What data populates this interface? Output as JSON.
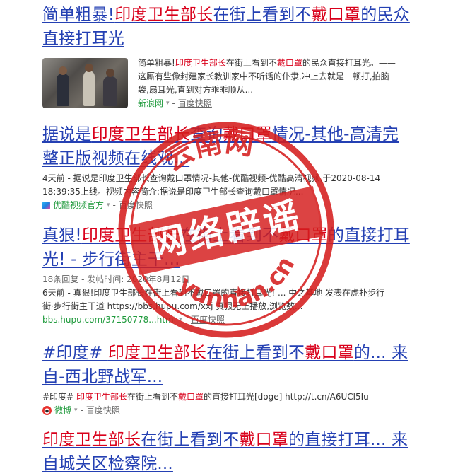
{
  "results": [
    {
      "title_plain_a": "简单粗暴!",
      "title_hl_a": "印度卫生部长",
      "title_plain_b": "在街上看到不",
      "title_hl_b": "戴口罩",
      "title_plain_c": "的民众",
      "title_line2": "直接打耳光",
      "snippet_plain_a": "简单粗暴!",
      "snippet_hl_a": "印度卫生部长",
      "snippet_plain_b": "在街上看到不",
      "snippet_hl_b": "戴口罩",
      "snippet_plain_c": "的民众直接打耳光。——",
      "snippet_line2": "这厮有些像封建家长教训家中不听话的仆隶,冲上去就是一顿打,拍脑",
      "snippet_line3": "袋,扇耳光,直到对方乖乖顺从...",
      "site": "新浪网",
      "cache": "百度快照"
    },
    {
      "title_plain_a": "据说是",
      "title_hl_a": "印度卫生部长",
      "title_plain_b": "查询",
      "title_hl_b": "戴口罩",
      "title_plain_c": "情况-其他-高清完",
      "title_line2": "整正版视频在线观...",
      "snippet_line1": "4天前 - 据说是印度卫生部长查询戴口罩情况-其他-优酷视频-优酷高清视频,于2020-08-14",
      "snippet_line2": "18:39:35上线。视频内容简介:据说是印度卫生部长查询戴口罩情况...",
      "site": "优酷视频官方",
      "cache": "百度快照"
    },
    {
      "title_plain_a": "真狠!",
      "title_hl_a": "印度卫生部长",
      "title_plain_b": "在街上看到不",
      "title_hl_b": "戴口罩",
      "title_plain_c": "的直接打耳",
      "title_line2": "光! - 步行街主干...",
      "meta": "18条回复 - 发帖时间: 2020年8月12日",
      "snippet_line1": "6天前 - 真狠!印度卫生部长在街上看到不戴口罩的直接打耳光! ... 中之基地 发表在虎扑步行",
      "snippet_line2": "街·步行街主干道 https://bbs.hupu.com/xxj 真狠无上播放,浏览数...",
      "url": "bbs.hupu.com/37150778...html",
      "cache": "百度快照"
    },
    {
      "title_plain_a": "#印度# ",
      "title_hl_a": "印度卫生部长",
      "title_plain_b": "在街上看到不",
      "title_hl_b": "戴口罩",
      "title_plain_c": "的... 来",
      "title_line2": "自-西北野战军...",
      "snippet_plain_a": "#印度# ",
      "snippet_hl_a": "印度卫生部长",
      "snippet_plain_b": "在街上看到不",
      "snippet_hl_b": "戴口罩",
      "snippet_plain_c": "的直接打耳光[doge] http://t.cn/A6UCl5Iu",
      "site": "微博",
      "cache": "百度快照"
    },
    {
      "title_hl_a": "印度卫生部长",
      "title_plain_b": "在街上看到不",
      "title_hl_b": "戴口罩",
      "title_plain_c": "的直接打耳... 来",
      "title_line2": "自城关区检察院..."
    }
  ],
  "stamp": {
    "main_text": "网络辟谣",
    "top_text": "云南网",
    "bottom_text": "yunnan.cn",
    "color": "#d51e1e"
  }
}
